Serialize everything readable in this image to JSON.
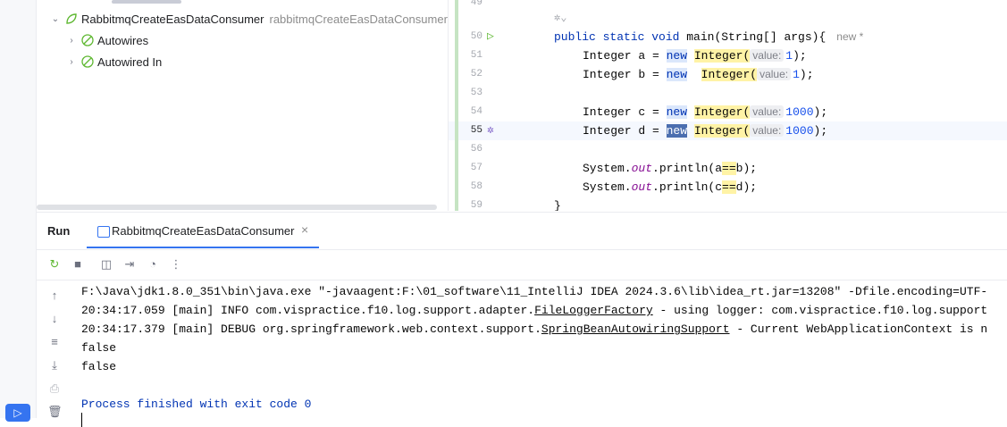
{
  "tree": {
    "root": {
      "label": "RabbitmqCreateEasDataConsumer",
      "hint": "rabbitmqCreateEasDataConsumer"
    },
    "children": [
      {
        "label": "Autowires"
      },
      {
        "label": "Autowired In"
      }
    ]
  },
  "editor": {
    "line_numbers": [
      "49",
      "50",
      "51",
      "52",
      "53",
      "54",
      "55",
      "56",
      "57",
      "58",
      "59"
    ],
    "inlay_author": "new *",
    "hint_value": "value:",
    "lines": {
      "l50": {
        "kw1": "public static void",
        "rest": " main(String[] args){"
      },
      "l51": {
        "pre": "Integer a = ",
        "new": "new",
        "type": "Integer(",
        "arg": "1",
        "end": ");"
      },
      "l52": {
        "pre": "Integer b = ",
        "new": "new",
        "type": "Integer(",
        "arg": "1",
        "end": ");"
      },
      "l54": {
        "pre": "Integer c = ",
        "new": "new",
        "type": "Integer(",
        "arg": "1000",
        "end": ");"
      },
      "l55": {
        "pre": "Integer d = ",
        "new": "new",
        "type": "Integer(",
        "arg": "1000",
        "end": ");"
      },
      "l57": {
        "a": "System.",
        "fld": "out",
        "b": ".println(a",
        "eq": "==",
        "c": "b);"
      },
      "l58": {
        "a": "System.",
        "fld": "out",
        "b": ".println(c",
        "eq": "==",
        "c": "d);"
      },
      "l59": {
        "brace": "}"
      }
    }
  },
  "run_panel": {
    "label": "Run",
    "tab_label": "RabbitmqCreateEasDataConsumer",
    "tab_close": "×"
  },
  "console": {
    "line1": "F:\\Java\\jdk1.8.0_351\\bin\\java.exe \"-javaagent:F:\\01_software\\11_IntelliJ IDEA 2024.3.6\\lib\\idea_rt.jar=13208\" -Dfile.encoding=UTF-",
    "line2_pre": "20:34:17.059 [main] INFO com.vispractice.f10.log.support.adapter.",
    "line2_link": "FileLoggerFactory",
    "line2_post": " - using logger: com.vispractice.f10.log.support",
    "line3_pre": "20:34:17.379 [main] DEBUG org.springframework.web.context.support.",
    "line3_link": "SpringBeanAutowiringSupport",
    "line3_post": " - Current WebApplicationContext is n",
    "line4": "false",
    "line5": "false",
    "line7": "Process finished with exit code 0"
  },
  "colors": {
    "accent": "#3574f0",
    "keyword": "#0033b3",
    "number": "#1750eb"
  }
}
